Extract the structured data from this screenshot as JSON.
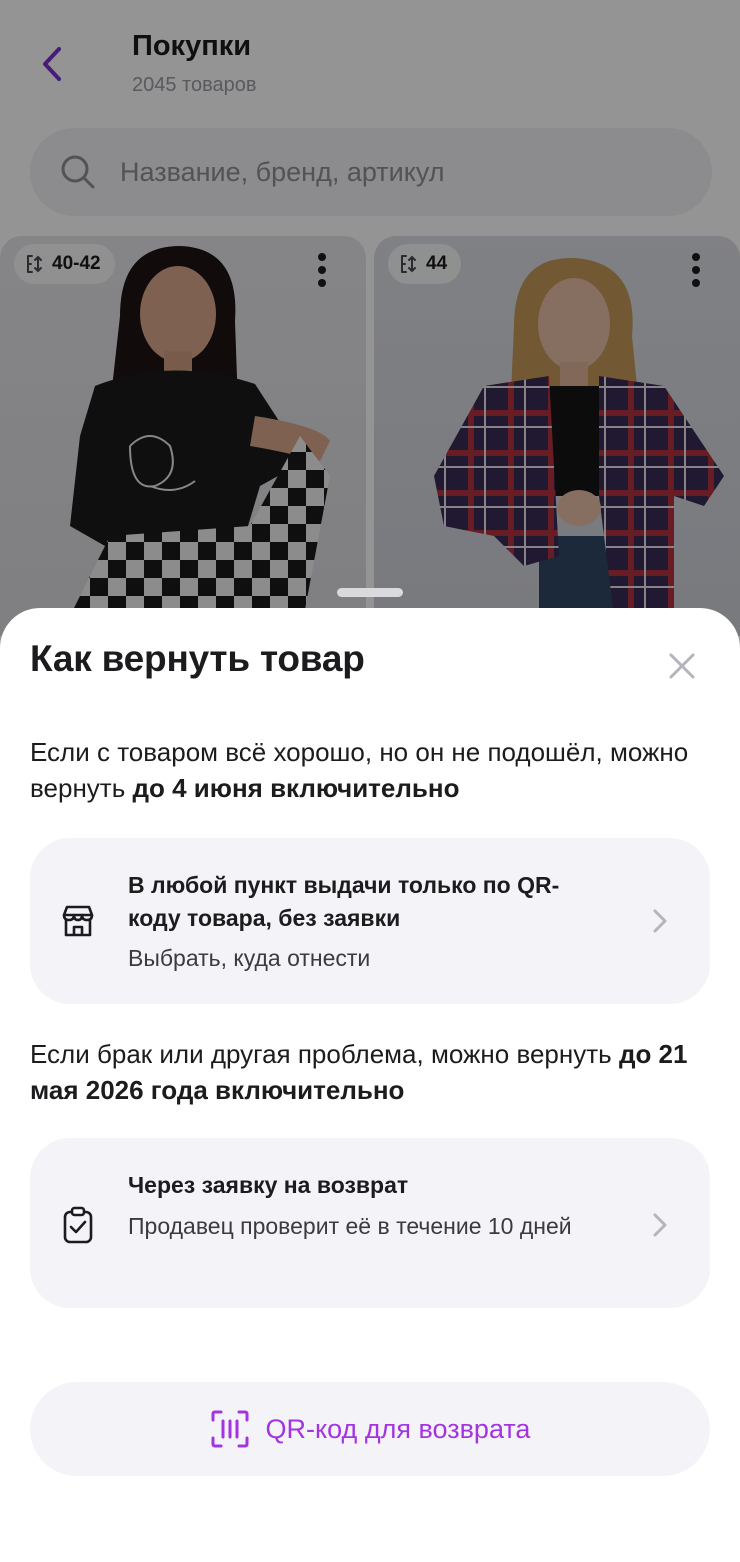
{
  "header": {
    "title": "Покупки",
    "subtitle": "2045 товаров",
    "back_icon": "chevron-left-icon"
  },
  "search": {
    "placeholder": "Название, бренд, артикул",
    "icon": "search-icon"
  },
  "products": [
    {
      "size": "40-42",
      "size_icon": "size-icon",
      "menu_icon": "more-vertical-icon"
    },
    {
      "size": "44",
      "size_icon": "size-icon",
      "menu_icon": "more-vertical-icon"
    }
  ],
  "sheet": {
    "title": "Как вернуть товар",
    "close_icon": "close-icon",
    "return_ok": {
      "text_start": "Если с товаром всё хорошо, но он не подошёл, можно вернуть ",
      "text_bold": "до 4 июня включительно"
    },
    "option_pickup": {
      "icon": "store-icon",
      "title": "В любой пункт выдачи только по QR-коду товара, без заявки",
      "description": "Выбрать, куда отнести",
      "chevron_icon": "chevron-right-icon"
    },
    "return_defect": {
      "text_start": "Если брак или другая проблема, можно вернуть ",
      "text_bold": "до 21 мая 2026 года включительно"
    },
    "option_request": {
      "icon": "clipboard-check-icon",
      "title": "Через заявку на возврат",
      "description": "Продавец проверит её в течение 10 дней",
      "chevron_icon": "chevron-right-icon"
    },
    "qr_button": {
      "icon": "barcode-scan-icon",
      "label": "QR-код для возврата"
    }
  },
  "colors": {
    "accent": "#a334e0",
    "back_arrow": "#7b2fd0",
    "overlay": "rgba(0,0,0,0.42)",
    "card_bg": "#f4f4f8"
  }
}
